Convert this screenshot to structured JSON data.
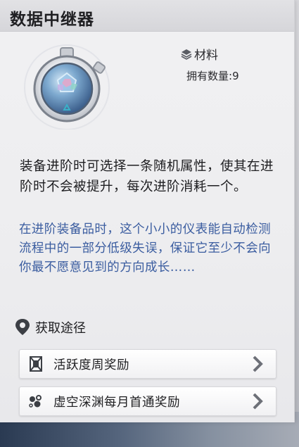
{
  "title": "数据中继器",
  "item": {
    "category": "材料",
    "owned_label": "拥有数量:",
    "owned_count": "9",
    "icon": "data-relay-gem-icon"
  },
  "description": "装备进阶时可选择一条随机属性，使其在进阶时不会被提升，每次进阶消耗一个。",
  "lore": "在进阶装备品时，这个小小的仪表能自动检测流程中的一部分低级失误，保证它至少不会向你最不愿意见到的方向成长……",
  "sources": {
    "heading": "获取途径",
    "items": [
      {
        "label": "活跃度周奖励",
        "icon": "weekly-activity-icon"
      },
      {
        "label": "虚空深渊每月首通奖励",
        "icon": "void-abyss-icon"
      }
    ]
  },
  "colors": {
    "lore_text": "#3b5da0",
    "panel_bg": "#efeff1",
    "title_text": "#1f1f22"
  }
}
